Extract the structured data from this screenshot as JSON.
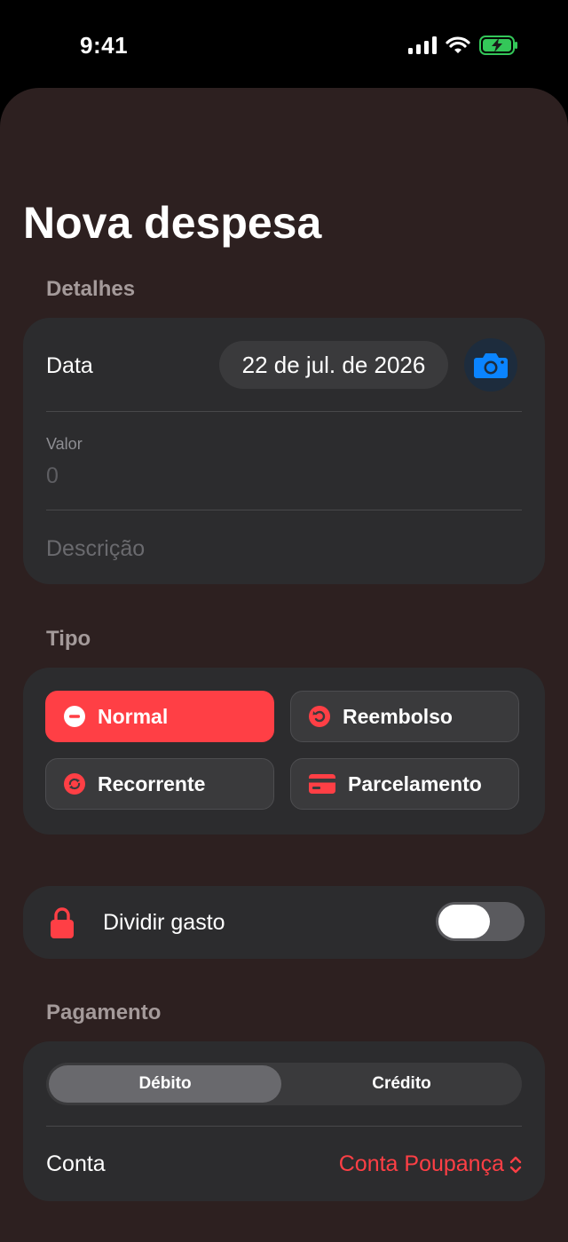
{
  "status_bar": {
    "time": "9:41"
  },
  "page": {
    "title": "Nova despesa"
  },
  "details": {
    "section_label": "Detalhes",
    "date_label": "Data",
    "date_value": "22 de jul. de 2026",
    "value_label": "Valor",
    "value_placeholder": "0",
    "description_placeholder": "Descrição"
  },
  "type": {
    "section_label": "Tipo",
    "options": [
      {
        "label": "Normal",
        "icon": "minus-circle-icon",
        "selected": true
      },
      {
        "label": "Reembolso",
        "icon": "refund-icon",
        "selected": false
      },
      {
        "label": "Recorrente",
        "icon": "repeat-icon",
        "selected": false
      },
      {
        "label": "Parcelamento",
        "icon": "credit-card-icon",
        "selected": false
      }
    ]
  },
  "split": {
    "label": "Dividir gasto",
    "icon": "lock-icon",
    "enabled": false
  },
  "payment": {
    "section_label": "Pagamento",
    "segments": [
      {
        "label": "Débito",
        "selected": true
      },
      {
        "label": "Crédito",
        "selected": false
      }
    ],
    "account_label": "Conta",
    "account_value": "Conta Poupança"
  },
  "colors": {
    "accent": "#ff3f45",
    "sheet_background": "#2d2020",
    "card_background": "#2c2c2e",
    "camera_blue": "#0a84ff"
  }
}
